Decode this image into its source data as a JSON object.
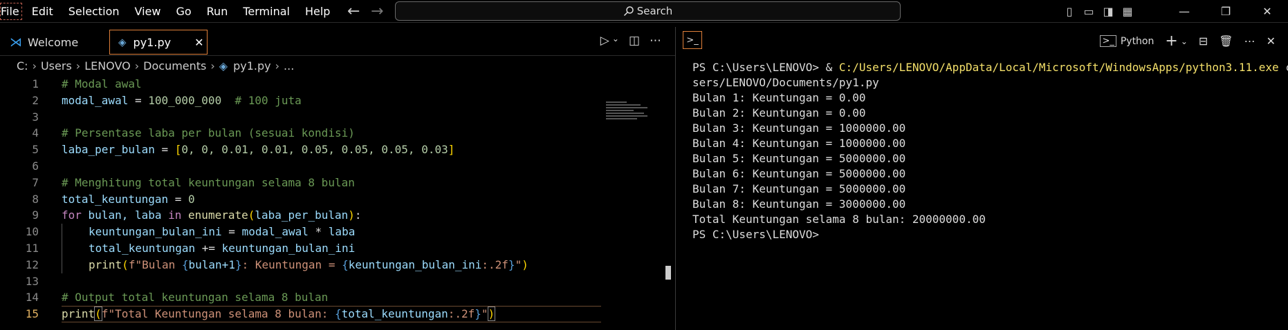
{
  "menu": [
    "File",
    "Edit",
    "Selection",
    "View",
    "Go",
    "Run",
    "Terminal",
    "Help"
  ],
  "search": {
    "label": "Search"
  },
  "tabs": [
    {
      "label": "Welcome"
    },
    {
      "label": "py1.py"
    }
  ],
  "breadcrumb": [
    "C:",
    "Users",
    "LENOVO",
    "Documents",
    "py1.py",
    "..."
  ],
  "code": {
    "line_numbers": [
      "1",
      "2",
      "3",
      "4",
      "5",
      "6",
      "7",
      "8",
      "9",
      "10",
      "11",
      "12",
      "13",
      "14",
      "15"
    ],
    "l1": "# Modal awal",
    "l2a": "modal_awal",
    "l2b": " = ",
    "l2c": "100_000_000",
    "l2d": "  # 100 juta",
    "l4": "# Persentase laba per bulan (sesuai kondisi)",
    "l5a": "laba_per_bulan",
    "l5b": " = ",
    "l5c": "[",
    "l5d": "0, 0, 0.01, 0.01, 0.05, 0.05, 0.05, 0.03",
    "l5e": "]",
    "l7": "# Menghitung total keuntungan selama 8 bulan",
    "l8a": "total_keuntungan",
    "l8b": " = ",
    "l8c": "0",
    "l9a": "for",
    "l9b": " bulan, laba ",
    "l9c": "in",
    "l9d": " enumerate",
    "l9e": "(",
    "l9f": "laba_per_bulan",
    "l9g": ")",
    "l9h": ":",
    "l10a": "keuntungan_bulan_ini",
    "l10b": " = ",
    "l10c": "modal_awal",
    "l10d": " * ",
    "l10e": "laba",
    "l11a": "total_keuntungan",
    "l11b": " += ",
    "l11c": "keuntungan_bulan_ini",
    "l12a": "print",
    "l12b": "(",
    "l12c": "f\"Bulan ",
    "l12d": "{",
    "l12e": "bulan+1",
    "l12f": "}",
    "l12g": ": Keuntungan = ",
    "l12h": "{",
    "l12i": "keuntungan_bulan_ini",
    "l12j": ":.2f",
    "l12k": "}",
    "l12l": "\"",
    "l12m": ")",
    "l14": "# Output total keuntungan selama 8 bulan",
    "l15a": "print",
    "l15b": "(",
    "l15c": "f\"Total Keuntungan selama 8 bulan: ",
    "l15d": "{",
    "l15e": "total_keuntungan",
    "l15f": ":.2f",
    "l15g": "}",
    "l15h": "\"",
    "l15i": ")"
  },
  "terminal": {
    "profile": "Python",
    "cmd_prompt": "PS C:\\Users\\LENOVO> & ",
    "cmd_exe": "C:/Users/LENOVO/AppData/Local/Microsoft/WindowsApps/python3.11.exe",
    "cmd_arg1": " c:/U",
    "cmd_arg2": "sers/LENOVO/Documents/py1.py",
    "output": [
      "Bulan 1: Keuntungan = 0.00",
      "Bulan 2: Keuntungan = 0.00",
      "Bulan 3: Keuntungan = 1000000.00",
      "Bulan 4: Keuntungan = 1000000.00",
      "Bulan 5: Keuntungan = 5000000.00",
      "Bulan 6: Keuntungan = 5000000.00",
      "Bulan 7: Keuntungan = 5000000.00",
      "Bulan 8: Keuntungan = 3000000.00",
      "Total Keuntungan selama 8 bulan: 20000000.00",
      "PS C:\\Users\\LENOVO>"
    ]
  },
  "colors": {
    "accent": "#e0803a",
    "comment": "#6a9955",
    "variable": "#9cdcfe",
    "number": "#b5cea8",
    "keyword": "#c586c0",
    "function": "#dcdcaa",
    "string": "#ce9178",
    "path": "#f4e06a"
  }
}
